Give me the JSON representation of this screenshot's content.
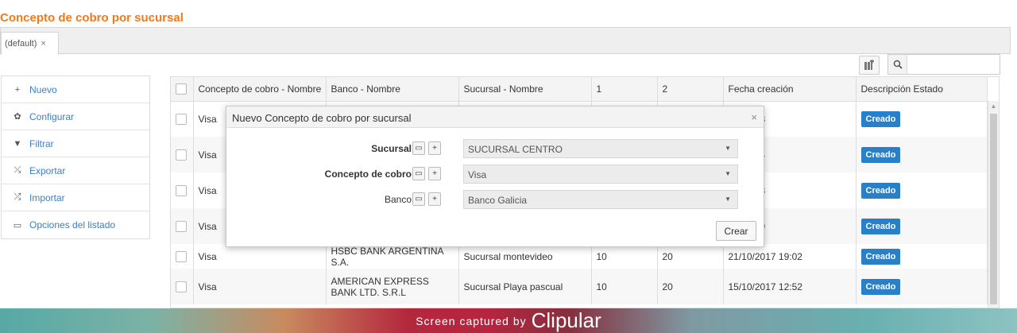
{
  "page": {
    "title": "Concepto de cobro por sucursal"
  },
  "tabs": [
    {
      "label": "(default)",
      "close": "×"
    }
  ],
  "search": {
    "placeholder": ""
  },
  "sidebar": {
    "items": [
      {
        "label": "Nuevo",
        "icon": "plus-icon"
      },
      {
        "label": "Configurar",
        "icon": "gear-icon"
      },
      {
        "label": "Filtrar",
        "icon": "filter-icon"
      },
      {
        "label": "Exportar",
        "icon": "export-icon"
      },
      {
        "label": "Importar",
        "icon": "import-icon"
      },
      {
        "label": "Opciones del listado",
        "icon": "print-icon"
      }
    ]
  },
  "table": {
    "columns": [
      "Concepto de cobro - Nombre",
      "Banco - Nombre",
      "Sucursal - Nombre",
      "1",
      "2",
      "Fecha creación",
      "Descripción Estado"
    ],
    "rows": [
      {
        "concepto": "Visa",
        "banco": "",
        "sucursal": "",
        "c1": "",
        "c2": "",
        "fecha": "18 00:28",
        "estado": "Creado"
      },
      {
        "concepto": "Visa",
        "banco": "",
        "sucursal": "",
        "c1": "",
        "c2": "",
        "fecha": "18 00:34",
        "estado": "Creado"
      },
      {
        "concepto": "Visa",
        "banco": "",
        "sucursal": "",
        "c1": "",
        "c2": "",
        "fecha": "18 01:33",
        "estado": "Creado"
      },
      {
        "concepto": "Visa",
        "banco": "",
        "sucursal": "",
        "c1": "",
        "c2": "",
        "fecha": "17 00:59",
        "estado": "Creado"
      },
      {
        "concepto": "Visa",
        "banco": "HSBC BANK ARGENTINA S.A.",
        "sucursal": "Sucursal montevideo",
        "c1": "10",
        "c2": "20",
        "fecha": "21/10/2017 19:02",
        "estado": "Creado"
      },
      {
        "concepto": "Visa",
        "banco": "AMERICAN EXPRESS BANK LTD. S.R.L",
        "sucursal": "Sucursal Playa pascual",
        "c1": "10",
        "c2": "20",
        "fecha": "15/10/2017 12:52",
        "estado": "Creado"
      }
    ]
  },
  "dialog": {
    "title": "Nuevo Concepto de cobro por sucursal",
    "close": "×",
    "fields": [
      {
        "label": "Sucursal",
        "value": "SUCURSAL CENTRO"
      },
      {
        "label": "Concepto de cobro",
        "value": "Visa"
      },
      {
        "label": "Banco",
        "value": "Banco Galicia"
      }
    ],
    "submit_label": "Crear"
  },
  "footer": {
    "text": "Screen captured by",
    "brand": "Clipular"
  }
}
